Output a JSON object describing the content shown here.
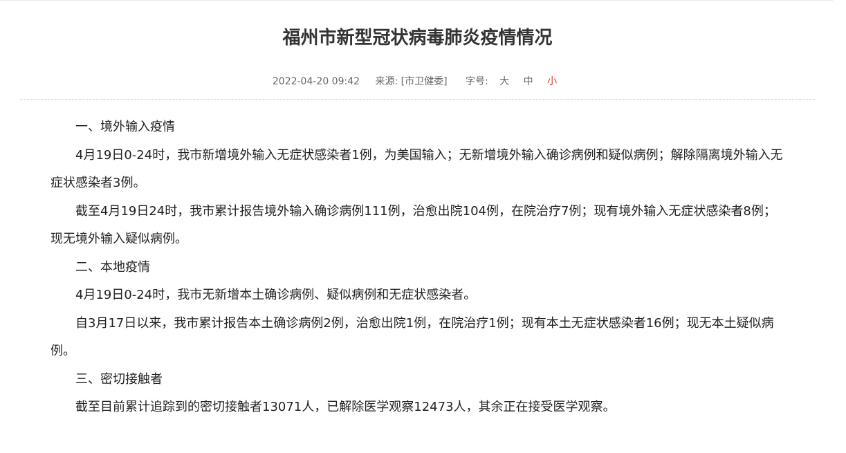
{
  "article": {
    "title": "福州市新型冠状病毒肺炎疫情情况",
    "date": "2022-04-20 09:42",
    "source": "来源: [市卫健委]",
    "font_size_label": "字号:",
    "font_size_options": [
      "大",
      "中",
      "小"
    ],
    "active_font_size": "小",
    "paragraphs": [
      "一、境外输入疫情",
      "4月19日0-24时，我市新增境外输入无症状感染者1例，为美国输入；无新增境外输入确诊病例和疑似病例；解除隔离境外输入无症状感染者3例。",
      "截至4月19日24时，我市累计报告境外输入确诊病例111例，治愈出院104例，在院治疗7例；现有境外输入无症状感染者8例；现无境外输入疑似病例。",
      "二、本地疫情",
      "4月19日0-24时，我市无新增本土确诊病例、疑似病例和无症状感染者。",
      "自3月17日以来，我市累计报告本土确诊病例2例，治愈出院1例，在院治疗1例；现有本土无症状感染者16例；现无本土疑似病例。",
      "三、密切接触者",
      "截至目前累计追踪到的密切接触者13071人，已解除医学观察12473人，其余正在接受医学观察。"
    ]
  },
  "colors": {
    "active_font_size": "#d43f2a",
    "meta_text": "#666666",
    "title_text": "#333333"
  }
}
